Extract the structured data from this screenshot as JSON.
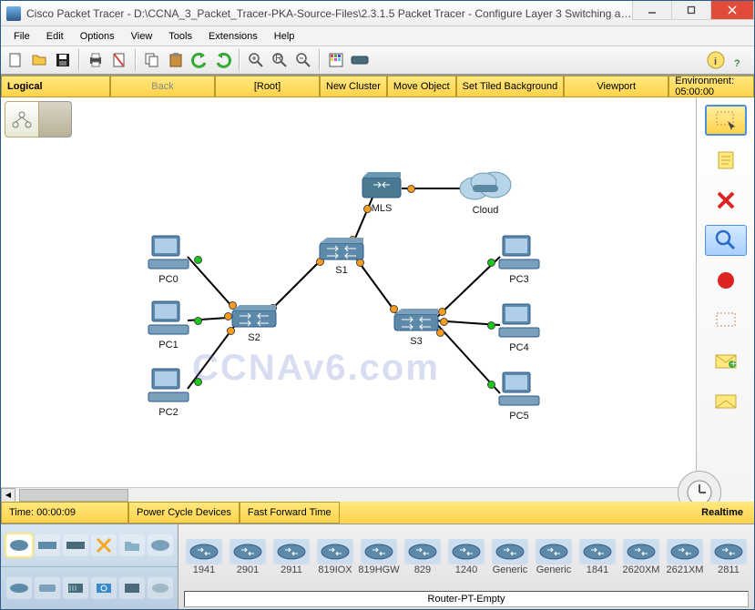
{
  "window": {
    "title": "Cisco Packet Tracer - D:\\CCNA_3_Packet_Tracer-PKA-Source-Files\\2.3.1.5 Packet Tracer - Configure Layer 3 Switching and inter-..."
  },
  "menu": [
    "File",
    "Edit",
    "Options",
    "View",
    "Tools",
    "Extensions",
    "Help"
  ],
  "navbar": {
    "logical": "Logical",
    "back": "Back",
    "root": "[Root]",
    "newcluster": "New Cluster",
    "moveobj": "Move Object",
    "tiled": "Set Tiled Background",
    "viewport": "Viewport",
    "env": "Environment: 05:00:00"
  },
  "devices": {
    "pc0": "PC0",
    "pc1": "PC1",
    "pc2": "PC2",
    "pc3": "PC3",
    "pc4": "PC4",
    "pc5": "PC5",
    "s1": "S1",
    "s2": "S2",
    "s3": "S3",
    "mls": "MLS",
    "cloud": "Cloud"
  },
  "watermark": "CCNAv6.com",
  "timebar": {
    "time": "Time: 00:00:09",
    "power": "Power Cycle Devices",
    "fast": "Fast Forward Time",
    "realtime": "Realtime"
  },
  "routers": [
    "1941",
    "2901",
    "2911",
    "819IOX",
    "819HGW",
    "829",
    "1240",
    "Generic",
    "Generic",
    "1841",
    "2620XM",
    "2621XM",
    "2811"
  ],
  "selected_device": "Router-PT-Empty"
}
